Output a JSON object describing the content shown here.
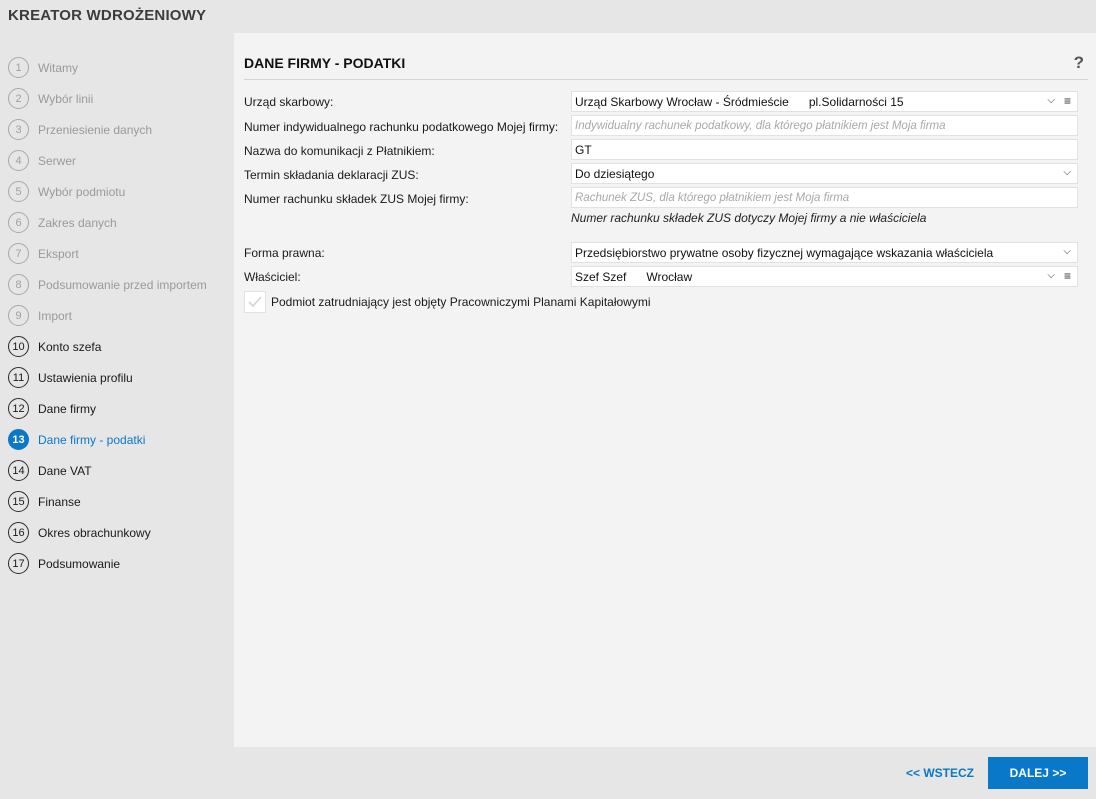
{
  "app": {
    "title": "KREATOR WDROŻENIOWY"
  },
  "steps": [
    {
      "num": "1",
      "label": "Witamy",
      "state": "done"
    },
    {
      "num": "2",
      "label": "Wybór linii",
      "state": "done"
    },
    {
      "num": "3",
      "label": "Przeniesienie danych",
      "state": "done"
    },
    {
      "num": "4",
      "label": "Serwer",
      "state": "done"
    },
    {
      "num": "5",
      "label": "Wybór podmiotu",
      "state": "done"
    },
    {
      "num": "6",
      "label": "Zakres danych",
      "state": "done"
    },
    {
      "num": "7",
      "label": "Eksport",
      "state": "done"
    },
    {
      "num": "8",
      "label": "Podsumowanie przed importem",
      "state": "done"
    },
    {
      "num": "9",
      "label": "Import",
      "state": "done"
    },
    {
      "num": "10",
      "label": "Konto szefa",
      "state": "todo"
    },
    {
      "num": "11",
      "label": "Ustawienia profilu",
      "state": "todo"
    },
    {
      "num": "12",
      "label": "Dane firmy",
      "state": "todo"
    },
    {
      "num": "13",
      "label": "Dane firmy - podatki",
      "state": "active"
    },
    {
      "num": "14",
      "label": "Dane VAT",
      "state": "todo"
    },
    {
      "num": "15",
      "label": "Finanse",
      "state": "todo"
    },
    {
      "num": "16",
      "label": "Okres obrachunkowy",
      "state": "todo"
    },
    {
      "num": "17",
      "label": "Podsumowanie",
      "state": "todo"
    }
  ],
  "form": {
    "title": "DANE FIRMY - PODATKI",
    "help": "?",
    "tax_office": {
      "label": "Urząd skarbowy:",
      "name": "Urząd Skarbowy Wrocław - Śródmieście",
      "address": "pl.Solidarności 15"
    },
    "tax_account": {
      "label": "Numer indywidualnego rachunku podatkowego Mojej firmy:",
      "placeholder": "Indywidualny rachunek podatkowy, dla którego płatnikiem jest Moja firma"
    },
    "payer_name": {
      "label": "Nazwa do komunikacji z Płatnikiem:",
      "value": "GT"
    },
    "zus_deadline": {
      "label": "Termin składania deklaracji ZUS:",
      "value": "Do dziesiątego"
    },
    "zus_account": {
      "label": "Numer rachunku składek ZUS Mojej firmy:",
      "placeholder": "Rachunek ZUS, dla którego płatnikiem jest Moja firma",
      "note": "Numer rachunku składek ZUS dotyczy Mojej firmy a nie właściciela"
    },
    "legal_form": {
      "label": "Forma prawna:",
      "value": "Przedsiębiorstwo prywatne osoby fizycznej wymagające wskazania właściciela"
    },
    "owner": {
      "label": "Właściciel:",
      "name": "Szef Szef",
      "city": "Wrocław"
    },
    "ppk": {
      "label": "Podmiot zatrudniający jest objęty Pracowniczymi Planami Kapitałowymi",
      "checked": false
    }
  },
  "footer": {
    "back_label": "<< WSTECZ",
    "next_label": "DALEJ >>"
  },
  "icons": {
    "chevron": "chevron-down-icon",
    "list": "list-menu-icon",
    "help": "help-icon",
    "check": "check-icon"
  },
  "colors": {
    "accent": "#0a78c8",
    "panel": "#f3f3f3",
    "background": "#e6e6e6"
  }
}
